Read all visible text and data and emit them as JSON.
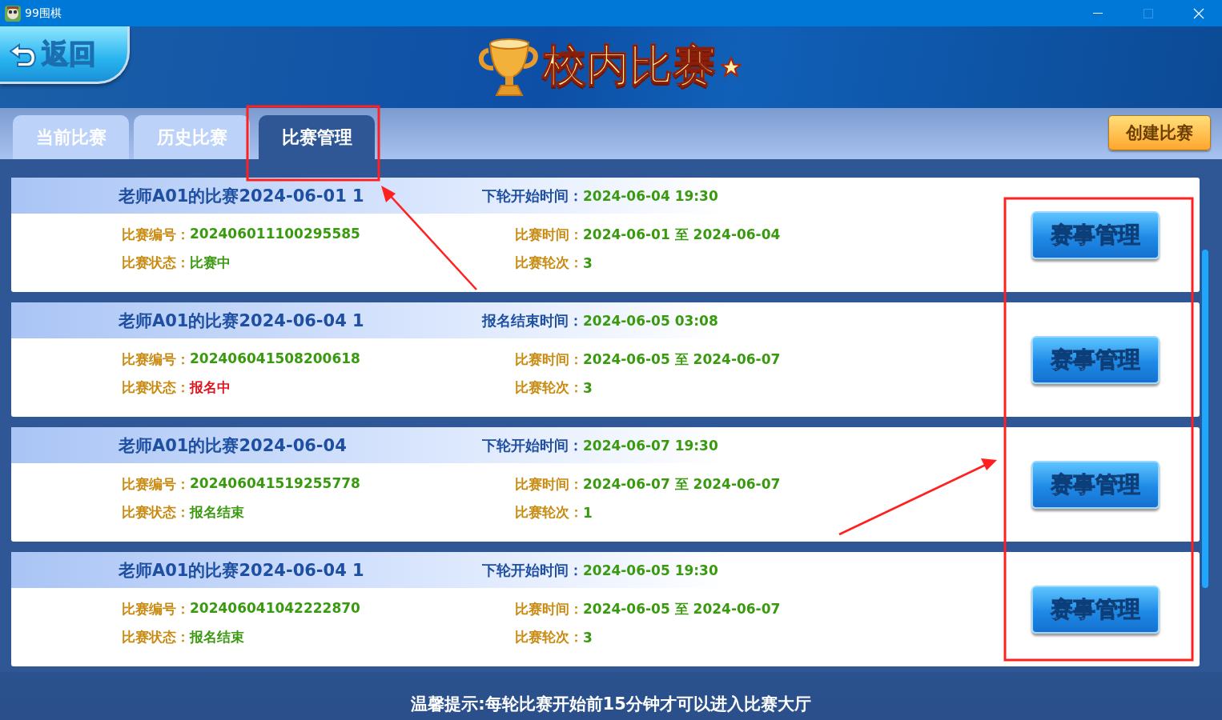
{
  "window": {
    "title": "99围棋"
  },
  "header": {
    "back_button": "返回",
    "title": "校内比赛"
  },
  "tabs": [
    {
      "label": "当前比赛",
      "selected": false
    },
    {
      "label": "历史比赛",
      "selected": false
    },
    {
      "label": "比赛管理",
      "selected": true
    }
  ],
  "create_button": "创建比赛",
  "matches": [
    {
      "title": "老师A01的比赛2024-06-01 1",
      "schedule_label": "下轮开始时间：",
      "schedule_value": "2024-06-04 19:30",
      "fields": [
        {
          "label": "比赛编号：",
          "value": "202406011100295585"
        },
        {
          "label": "比赛时间：",
          "value": "2024-06-01 至 2024-06-04"
        },
        {
          "label": "比赛状态：",
          "value": "比赛中",
          "color": "#3a9a0f"
        },
        {
          "label": "比赛轮次：",
          "value": "3"
        }
      ],
      "button": "赛事管理"
    },
    {
      "title": "老师A01的比赛2024-06-04 1",
      "schedule_label": "报名结束时间：",
      "schedule_value": "2024-06-05 03:08",
      "fields": [
        {
          "label": "比赛编号：",
          "value": "202406041508200618"
        },
        {
          "label": "比赛时间：",
          "value": "2024-06-05 至 2024-06-07"
        },
        {
          "label": "比赛状态：",
          "value": "报名中",
          "color": "#e0141e"
        },
        {
          "label": "比赛轮次：",
          "value": "3"
        }
      ],
      "button": "赛事管理"
    },
    {
      "title": "老师A01的比赛2024-06-04",
      "schedule_label": "下轮开始时间：",
      "schedule_value": "2024-06-07 19:30",
      "fields": [
        {
          "label": "比赛编号：",
          "value": "202406041519255778"
        },
        {
          "label": "比赛时间：",
          "value": "2024-06-07 至 2024-06-07"
        },
        {
          "label": "比赛状态：",
          "value": "报名结束",
          "color": "#3a9a0f"
        },
        {
          "label": "比赛轮次：",
          "value": "1"
        }
      ],
      "button": "赛事管理"
    },
    {
      "title": "老师A01的比赛2024-06-04 1",
      "schedule_label": "下轮开始时间：",
      "schedule_value": "2024-06-05 19:30",
      "fields": [
        {
          "label": "比赛编号：",
          "value": "202406041042222870"
        },
        {
          "label": "比赛时间：",
          "value": "2024-06-05 至 2024-06-07"
        },
        {
          "label": "比赛状态：",
          "value": "报名结束",
          "color": "#3a9a0f"
        },
        {
          "label": "比赛轮次：",
          "value": "3"
        }
      ],
      "button": "赛事管理"
    }
  ],
  "footer_tip": "温馨提示:每轮比赛开始前15分钟才可以进入比赛大厅"
}
